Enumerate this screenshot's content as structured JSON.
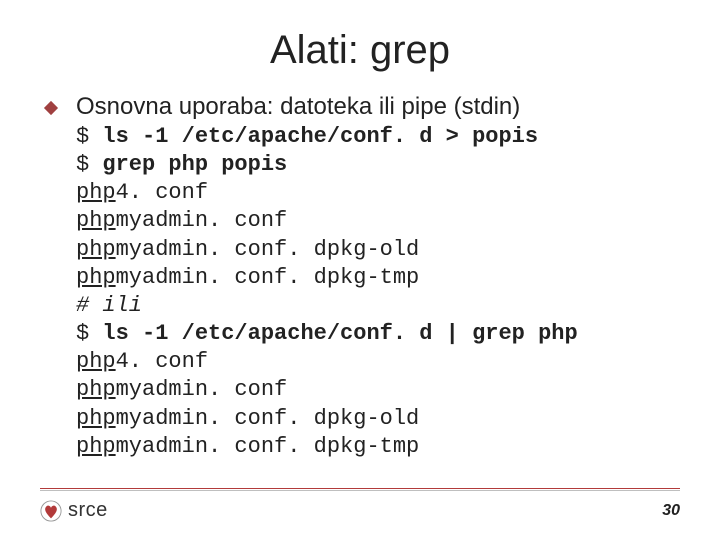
{
  "title": "Alati: grep",
  "bullet": "Osnovna uporaba: datoteka ili pipe (stdin)",
  "code": {
    "l1_prefix": "$ ",
    "l1": "ls -1 /etc/apache/conf. d > popis",
    "l2_prefix": "$ ",
    "l2": "grep php popis",
    "l3_hl": "php",
    "l3_rest": "4. conf",
    "l4_hl": "php",
    "l4_rest": "myadmin. conf",
    "l5_hl": "php",
    "l5_rest": "myadmin. conf. dpkg-old",
    "l6_hl": "php",
    "l6_rest": "myadmin. conf. dpkg-tmp",
    "l7": "# ili",
    "l8_prefix": "$ ",
    "l8": "ls -1 /etc/apache/conf. d | grep php",
    "l9_hl": "php",
    "l9_rest": "4. conf",
    "l10_hl": "php",
    "l10_rest": "myadmin. conf",
    "l11_hl": "php",
    "l11_rest": "myadmin. conf. dpkg-old",
    "l12_hl": "php",
    "l12_rest": "myadmin. conf. dpkg-tmp"
  },
  "footer": {
    "brand": "srce",
    "page": "30"
  }
}
